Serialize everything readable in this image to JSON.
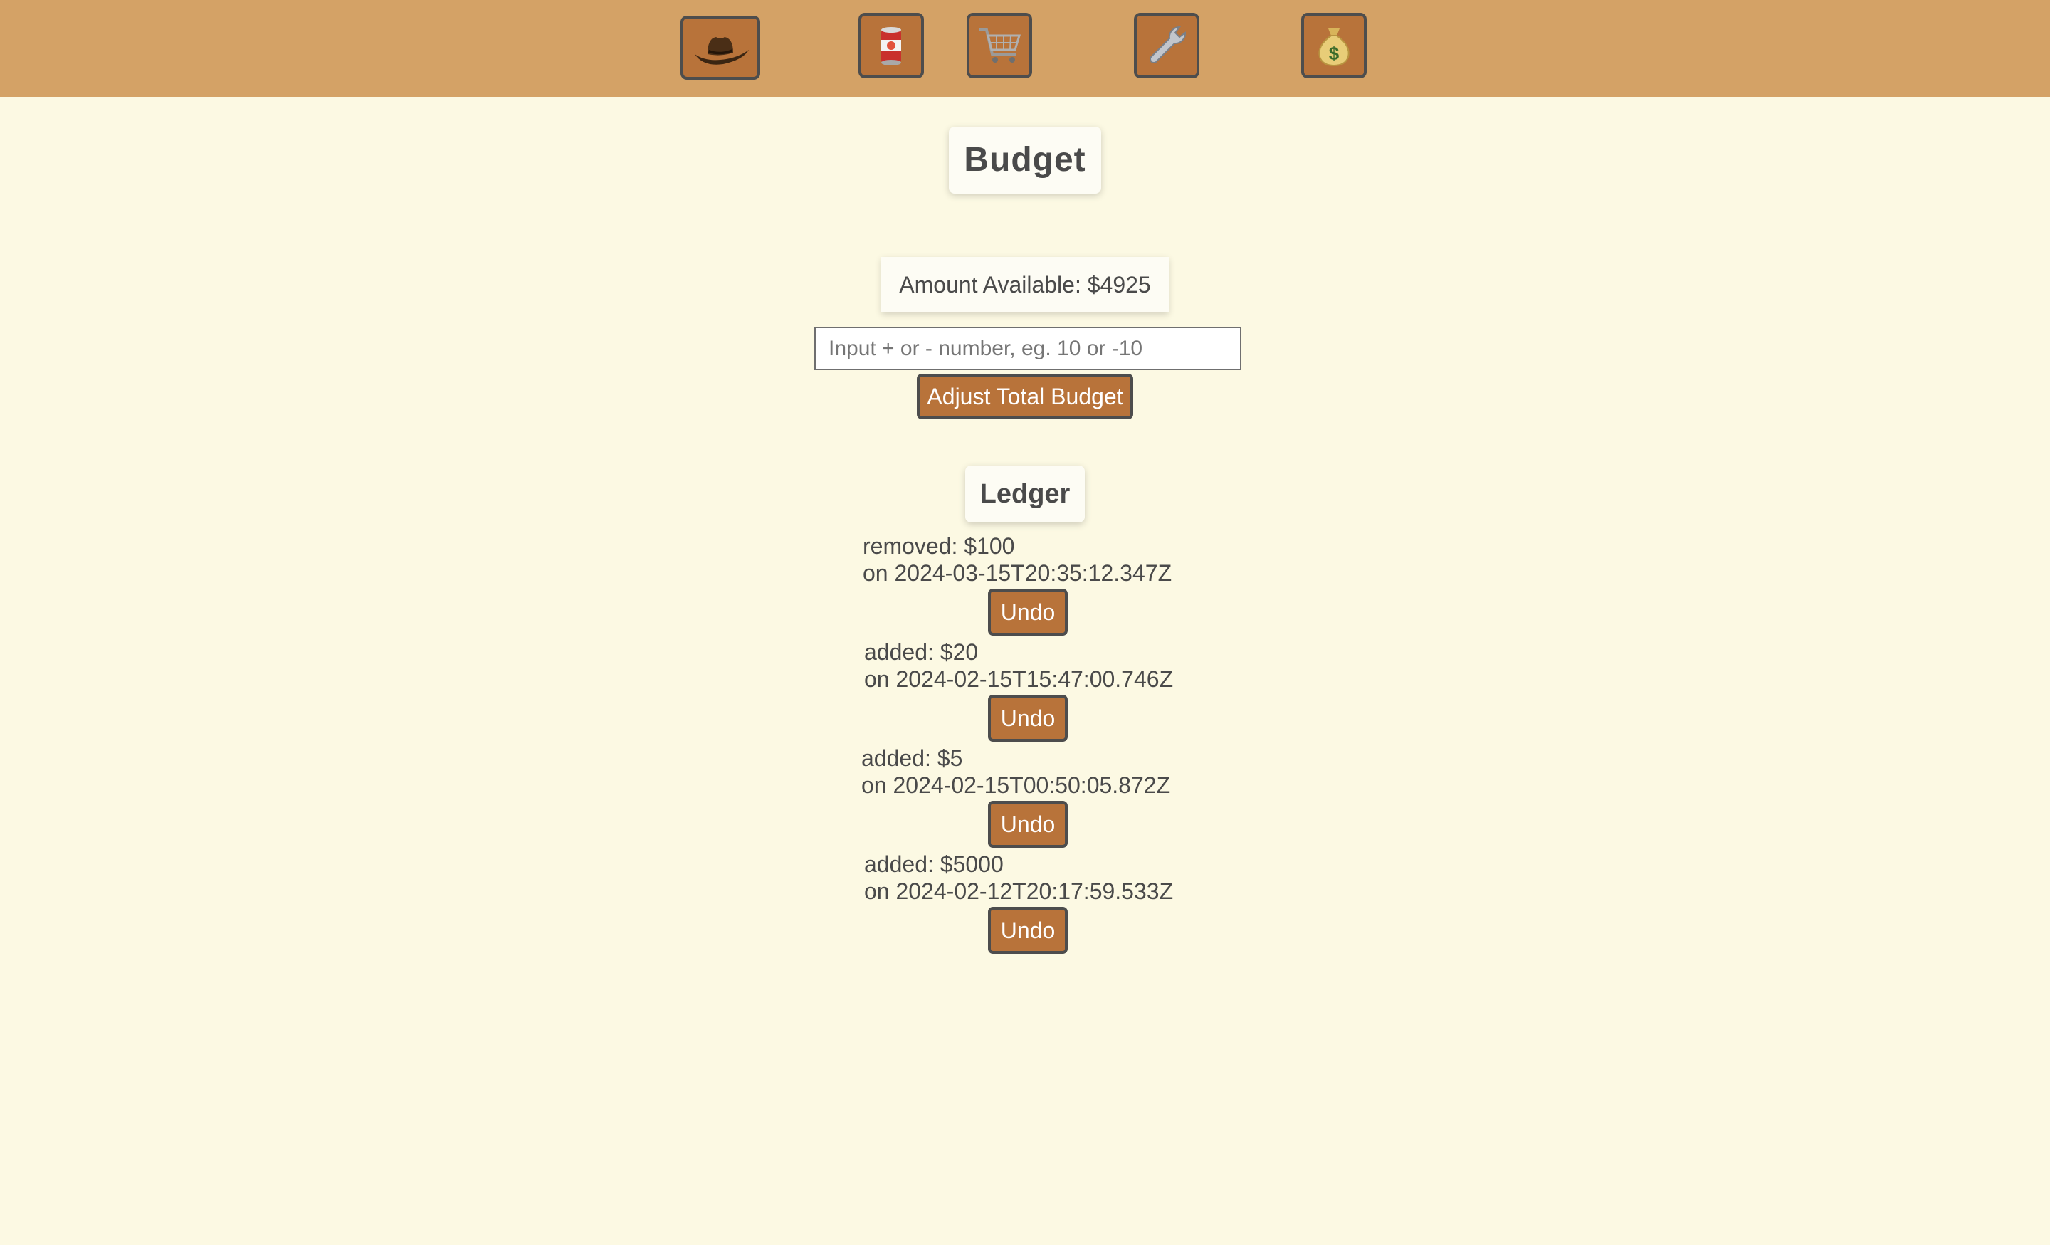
{
  "nav": {
    "items": [
      {
        "icon": "cowboy-hat-icon"
      },
      {
        "icon": "can-icon"
      },
      {
        "icon": "shopping-cart-icon"
      },
      {
        "icon": "wrench-icon"
      },
      {
        "icon": "money-bag-icon"
      }
    ]
  },
  "budget": {
    "title": "Budget",
    "amount_label": "Amount Available: $4925",
    "input_placeholder": "Input + or - number, eg. 10 or -10",
    "input_value": "",
    "adjust_label": "Adjust Total Budget"
  },
  "ledger": {
    "title": "Ledger",
    "entries": [
      {
        "action": "removed: $100",
        "date": "on 2024-03-15T20:35:12.347Z",
        "undo_label": "Undo"
      },
      {
        "action": "added: $20",
        "date": "on 2024-02-15T15:47:00.746Z",
        "undo_label": "Undo"
      },
      {
        "action": "added: $5",
        "date": "on 2024-02-15T00:50:05.872Z",
        "undo_label": "Undo"
      },
      {
        "action": "added: $5000",
        "date": "on 2024-02-12T20:17:59.533Z",
        "undo_label": "Undo"
      }
    ]
  },
  "colors": {
    "topbar": "#d4a266",
    "background": "#fcf9e3",
    "button": "#b8733a",
    "button_border": "#4d4d4d",
    "text": "#4a4a4a"
  }
}
